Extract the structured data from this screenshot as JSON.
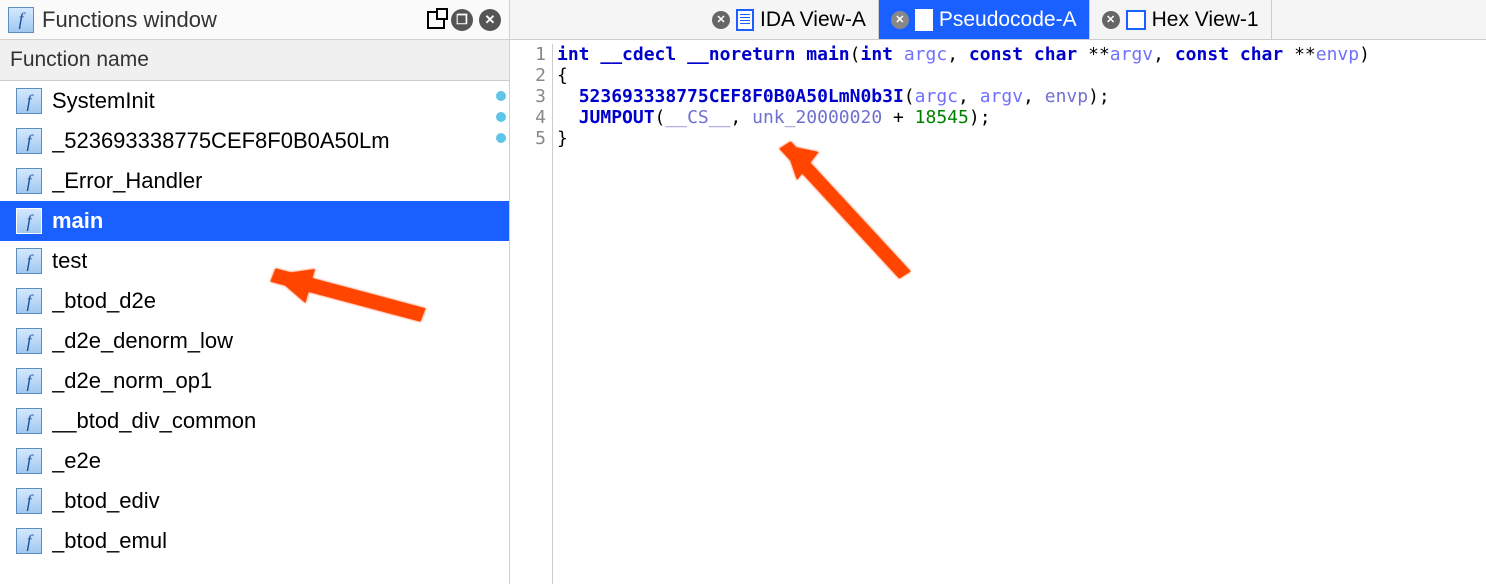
{
  "left_panel": {
    "title": "Functions window",
    "column_header": "Function name",
    "functions": [
      {
        "name": "SystemInit",
        "selected": false
      },
      {
        "name": "_523693338775CEF8F0B0A50Lm",
        "selected": false
      },
      {
        "name": "_Error_Handler",
        "selected": false
      },
      {
        "name": "main",
        "selected": true
      },
      {
        "name": "test",
        "selected": false
      },
      {
        "name": "_btod_d2e",
        "selected": false
      },
      {
        "name": "_d2e_denorm_low",
        "selected": false
      },
      {
        "name": "_d2e_norm_op1",
        "selected": false
      },
      {
        "name": "__btod_div_common",
        "selected": false
      },
      {
        "name": "_e2e",
        "selected": false
      },
      {
        "name": "_btod_ediv",
        "selected": false
      },
      {
        "name": "_btod_emul",
        "selected": false
      }
    ]
  },
  "tabs": [
    {
      "label": "IDA View-A",
      "active": false,
      "icon": "doc"
    },
    {
      "label": "Pseudocode-A",
      "active": true,
      "icon": "doc"
    },
    {
      "label": "Hex View-1",
      "active": false,
      "icon": "hex"
    }
  ],
  "code": {
    "lines": [
      {
        "num": "1",
        "bp": false
      },
      {
        "num": "2",
        "bp": false
      },
      {
        "num": "3",
        "bp": true
      },
      {
        "num": "4",
        "bp": true
      },
      {
        "num": "5",
        "bp": true
      }
    ],
    "tokens": {
      "l1_int": "int",
      "l1_cdecl": "__cdecl",
      "l1_noreturn": "__noreturn",
      "l1_main": "main",
      "l1_int2": "int",
      "l1_argc": "argc",
      "l1_const1": "const",
      "l1_char1": "char",
      "l1_argv": "argv",
      "l1_const2": "const",
      "l1_char2": "char",
      "l1_envp": "envp",
      "l2_brace": "{",
      "l3_fn": "523693338775CEF8F0B0A50LmN0b3I",
      "l3_argc": "argc",
      "l3_argv": "argv",
      "l3_envp": "envp",
      "l4_jumpout": "JUMPOUT",
      "l4_cs": "__CS__",
      "l4_unk": "unk_20000020",
      "l4_num": "18545",
      "l5_brace": "}"
    }
  }
}
